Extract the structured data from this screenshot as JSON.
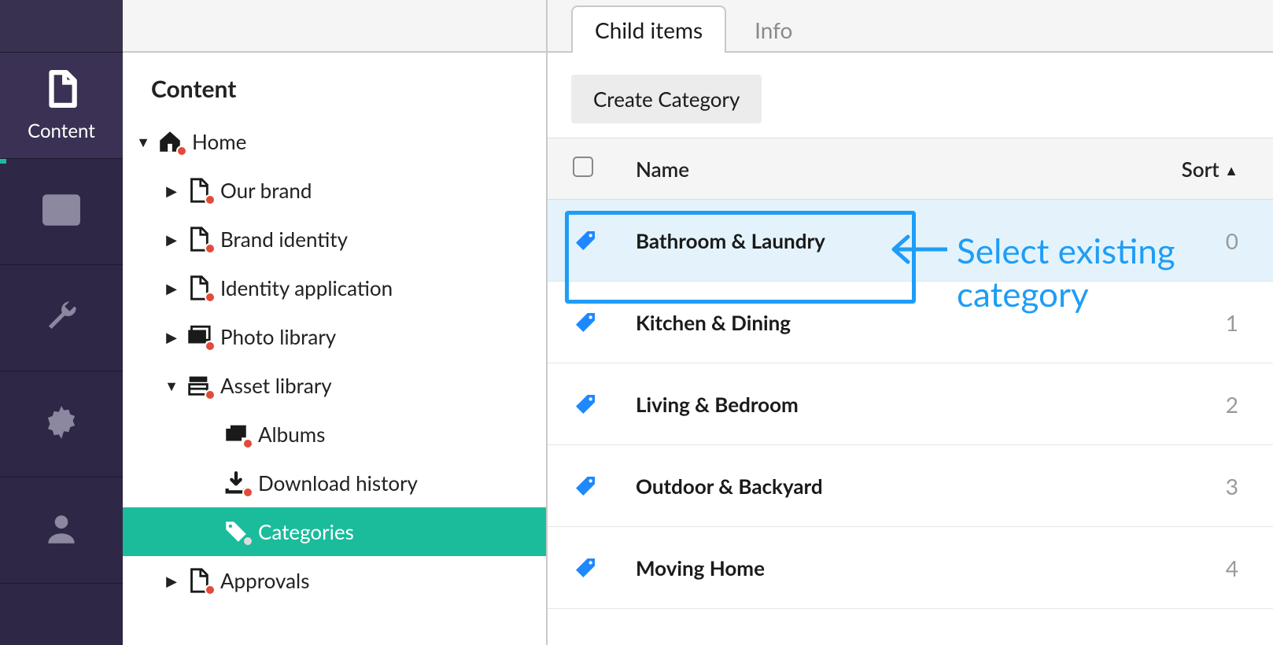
{
  "rail": {
    "items": [
      {
        "name": "content",
        "label": "Content",
        "selected": true
      },
      {
        "name": "media",
        "label": "",
        "selected": false
      },
      {
        "name": "tools",
        "label": "",
        "selected": false
      },
      {
        "name": "settings",
        "label": "",
        "selected": false
      },
      {
        "name": "users",
        "label": "",
        "selected": false
      }
    ]
  },
  "treepanel": {
    "title": "Content",
    "rows": [
      {
        "level": 0,
        "caret": "down",
        "icon": "home",
        "label": "Home",
        "selected": false
      },
      {
        "level": 1,
        "caret": "right",
        "icon": "page",
        "label": "Our brand",
        "selected": false
      },
      {
        "level": 1,
        "caret": "right",
        "icon": "page",
        "label": "Brand identity",
        "selected": false
      },
      {
        "level": 1,
        "caret": "right",
        "icon": "page",
        "label": "Identity application",
        "selected": false
      },
      {
        "level": 1,
        "caret": "right",
        "icon": "photos",
        "label": "Photo library",
        "selected": false
      },
      {
        "level": 1,
        "caret": "down",
        "icon": "asset",
        "label": "Asset library",
        "selected": false
      },
      {
        "level": 2,
        "caret": "none",
        "icon": "albums",
        "label": "Albums",
        "selected": false
      },
      {
        "level": 2,
        "caret": "none",
        "icon": "dl",
        "label": "Download history",
        "selected": false
      },
      {
        "level": 2,
        "caret": "none",
        "icon": "tags",
        "label": "Categories",
        "selected": true
      },
      {
        "level": 1,
        "caret": "right",
        "icon": "page",
        "label": "Approvals",
        "selected": false
      }
    ]
  },
  "tabs": [
    {
      "label": "Child items",
      "active": true
    },
    {
      "label": "Info",
      "active": false
    }
  ],
  "actions": {
    "create_label": "Create Category"
  },
  "table": {
    "header": {
      "name": "Name",
      "sort": "Sort"
    },
    "rows": [
      {
        "name": "Bathroom & Laundry",
        "sort": "0",
        "highlight": true
      },
      {
        "name": "Kitchen & Dining",
        "sort": "1",
        "highlight": false
      },
      {
        "name": "Living & Bedroom",
        "sort": "2",
        "highlight": false
      },
      {
        "name": "Outdoor & Backyard",
        "sort": "3",
        "highlight": false
      },
      {
        "name": "Moving Home",
        "sort": "4",
        "highlight": false
      }
    ]
  },
  "annotation": {
    "text": "Select existing category"
  },
  "colors": {
    "accent_teal": "#1ABC9C",
    "accent_blue": "#1E9DF7",
    "rail_bg": "#2F2746"
  }
}
